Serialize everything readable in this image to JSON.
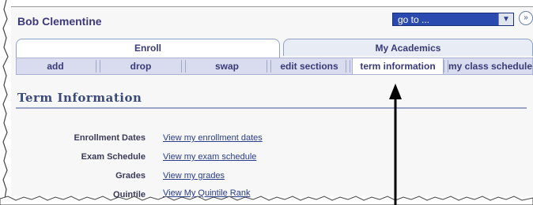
{
  "header": {
    "user_name": "Bob Clementine",
    "goto_value": "go to ...",
    "expand_glyph": "»"
  },
  "tabs": [
    {
      "label": "Enroll",
      "active": true
    },
    {
      "label": "My Academics",
      "active": false
    }
  ],
  "subnav": [
    {
      "label": "add"
    },
    {
      "label": "drop"
    },
    {
      "label": "swap"
    },
    {
      "label": "edit sections"
    },
    {
      "label": "term information",
      "active": true
    },
    {
      "label": "my class schedule"
    }
  ],
  "section": {
    "title": "Term Information",
    "rows": [
      {
        "label": "Enrollment Dates",
        "link": "View my enrollment dates"
      },
      {
        "label": "Exam Schedule",
        "link": "View my exam schedule"
      },
      {
        "label": "Grades",
        "link": "View my grades"
      },
      {
        "label": "Quintile",
        "link": "View My Quintile Rank"
      }
    ]
  },
  "colors": {
    "accent": "#3a3a7a",
    "goto_bg": "#2b4ab0",
    "subnav_bg": "#d9dcee",
    "link": "#2a3d8a"
  },
  "icons": {
    "goto_arrow": "chevron-down-icon",
    "expand": "double-chevron-right-icon",
    "callout": "arrow-up-icon"
  }
}
